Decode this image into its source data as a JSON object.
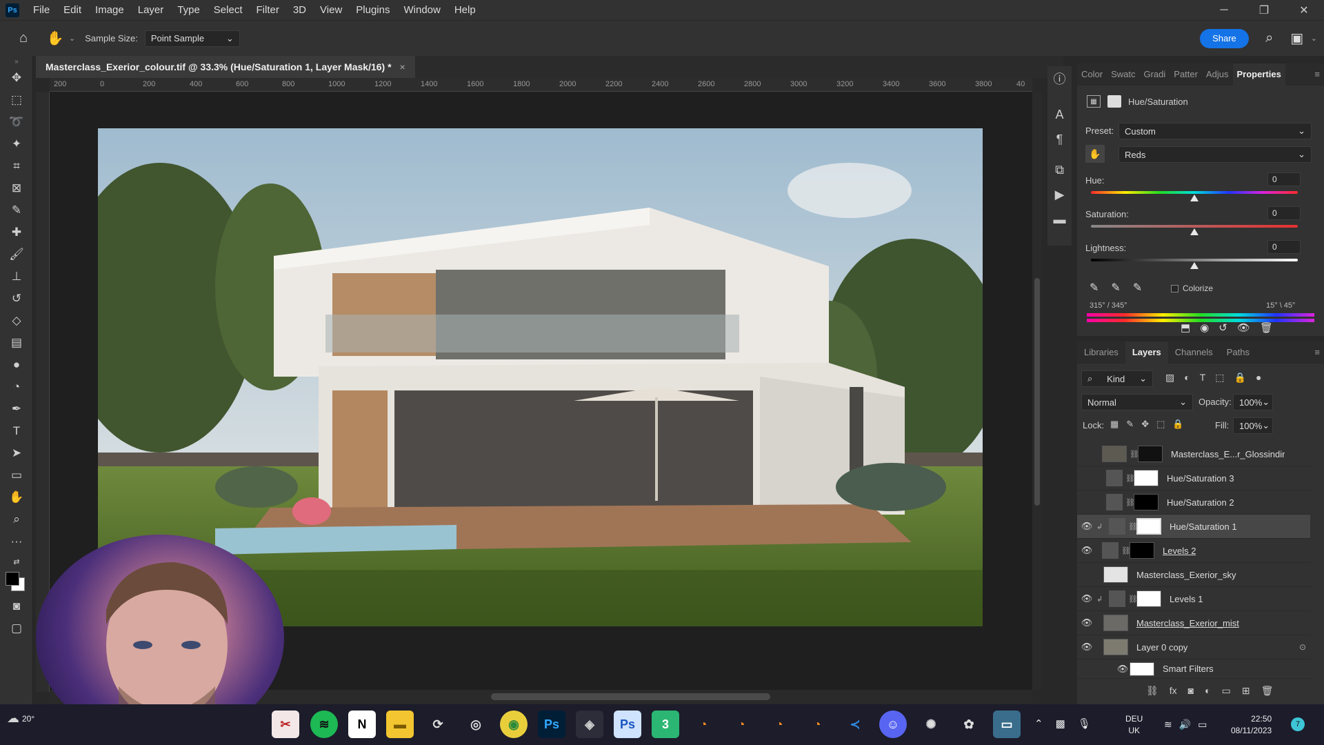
{
  "menu": {
    "logo": "Ps",
    "items": [
      "File",
      "Edit",
      "Image",
      "Layer",
      "Type",
      "Select",
      "Filter",
      "3D",
      "View",
      "Plugins",
      "Window",
      "Help"
    ]
  },
  "options": {
    "sample_size_label": "Sample Size:",
    "sample_size_value": "Point Sample",
    "share_label": "Share"
  },
  "document": {
    "tab_title": "Masterclass_Exerior_colour.tif @ 33.3% (Hue/Saturation 1, Layer Mask/16) *",
    "close": "×"
  },
  "ruler": {
    "ticks": [
      "200",
      "0",
      "200",
      "400",
      "600",
      "800",
      "1000",
      "1200",
      "1400",
      "1600",
      "1800",
      "2000",
      "2200",
      "2400",
      "2600",
      "2800",
      "3000",
      "3200",
      "3400",
      "3600",
      "3800",
      "40"
    ]
  },
  "properties": {
    "tabs": [
      "Color",
      "Swatc",
      "Gradi",
      "Patter",
      "Adjus",
      "Properties"
    ],
    "active_tab": "Properties",
    "title": "Hue/Saturation",
    "preset_label": "Preset:",
    "preset_value": "Custom",
    "channel_value": "Reds",
    "hue_label": "Hue:",
    "hue_value": "0",
    "saturation_label": "Saturation:",
    "saturation_value": "0",
    "lightness_label": "Lightness:",
    "lightness_value": "0",
    "colorize_label": "Colorize",
    "range_left": "315° / 345°",
    "range_right": "15° \\ 45°"
  },
  "layers_panel": {
    "tabs": [
      "Libraries",
      "Layers",
      "Channels",
      "Paths"
    ],
    "active_tab": "Layers",
    "filter_kind": "Kind",
    "blend_mode": "Normal",
    "opacity_label": "Opacity:",
    "opacity_value": "100%",
    "lock_label": "Lock:",
    "fill_label": "Fill:",
    "fill_value": "100%",
    "layers": [
      {
        "name": "Masterclass_E...r_Glossindir",
        "visible": false,
        "mask": "dark"
      },
      {
        "name": "Hue/Saturation 3",
        "visible": false,
        "mask": "white"
      },
      {
        "name": "Hue/Saturation 2",
        "visible": false,
        "mask": "black"
      },
      {
        "name": "Hue/Saturation 1",
        "visible": true,
        "mask": "white",
        "selected": true
      },
      {
        "name": "Levels 2",
        "visible": true,
        "mask": "black"
      },
      {
        "name": "Masterclass_Exerior_sky",
        "visible": false,
        "mask": "none"
      },
      {
        "name": "Levels 1",
        "visible": true,
        "mask": "white"
      },
      {
        "name": "Masterclass_Exerior_mist",
        "visible": true,
        "mask": "none"
      },
      {
        "name": "Layer 0 copy",
        "visible": true,
        "mask": "none"
      },
      {
        "name": "Smart Filters",
        "visible": true,
        "mask": "white"
      }
    ]
  },
  "taskbar": {
    "weather": "20°",
    "language_top": "DEU",
    "language_bottom": "UK",
    "time": "22:50",
    "date": "08/11/2023",
    "notifications": "7"
  },
  "colors": {
    "accent": "#1473e6",
    "panel": "#323232",
    "ps_blue": "#31a8ff"
  }
}
